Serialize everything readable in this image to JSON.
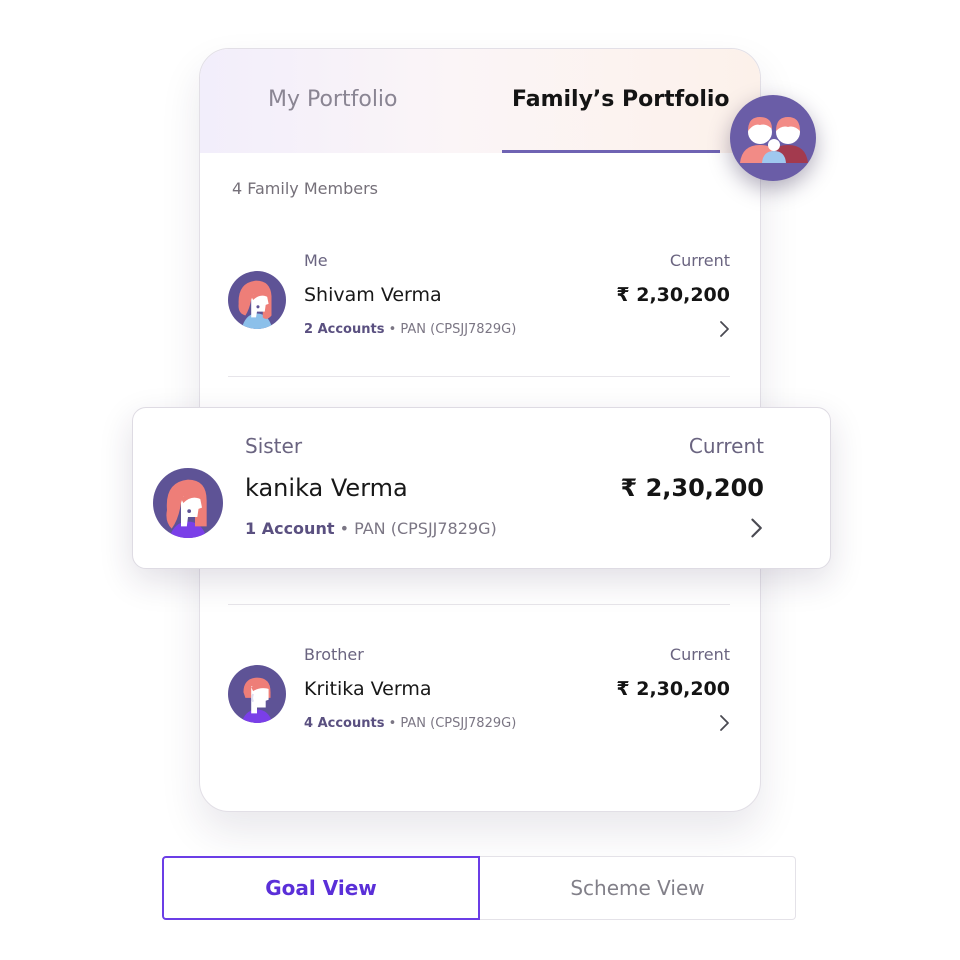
{
  "tabs": {
    "my_portfolio": "My Portfolio",
    "family_portfolio": "Family’s Portfolio",
    "active": "family_portfolio"
  },
  "members_count": "4 Family Members",
  "currency_symbol": "₹",
  "members": [
    {
      "relation": "Me",
      "name": "Shivam Verma",
      "current_label": "Current",
      "amount": "₹ 2,30,200",
      "accounts": "2 Accounts",
      "pan": " • PAN (CPSJJ7829G)"
    },
    {
      "relation": "Sister",
      "name": "kanika Verma",
      "current_label": "Current",
      "amount": "₹ 2,30,200",
      "accounts": "1 Account",
      "pan": " • PAN (CPSJJ7829G)"
    },
    {
      "relation": "Brother",
      "name": "Kritika Verma",
      "current_label": "Current",
      "amount": "₹ 2,30,200",
      "accounts": "4 Accounts",
      "pan": " • PAN (CPSJJ7829G)"
    }
  ],
  "views": {
    "goal": "Goal View",
    "scheme": "Scheme View",
    "selected": "goal"
  },
  "icons": {
    "family_badge": "family-group-icon",
    "chevron": "chevron-right-icon",
    "avatar_female": "avatar-woman-icon",
    "avatar_male": "avatar-man-icon"
  },
  "colors": {
    "accent": "#6f63b3",
    "selected_view": "#5a2fd8",
    "avatar_bg": "#5e5396",
    "hair": "#ee7e78"
  }
}
